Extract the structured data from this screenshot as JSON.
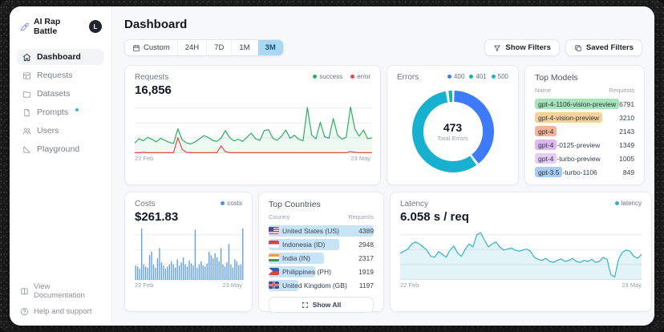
{
  "app": {
    "name": "AI Rap Battle",
    "avatar_initial": "L"
  },
  "sidebar": {
    "items": [
      {
        "label": "Dashboard"
      },
      {
        "label": "Requests"
      },
      {
        "label": "Datasets"
      },
      {
        "label": "Prompts"
      },
      {
        "label": "Users"
      },
      {
        "label": "Playground"
      }
    ],
    "footer": [
      {
        "label": "View Documentation"
      },
      {
        "label": "Help and support"
      }
    ]
  },
  "header": {
    "title": "Dashboard",
    "time_filters": [
      "Custom",
      "24H",
      "7D",
      "1M",
      "3M"
    ],
    "selected_filter": "3M",
    "show_filters": "Show Filters",
    "saved_filters": "Saved Filters"
  },
  "panels": {
    "requests": {
      "title": "Requests",
      "value": "16,856",
      "legend": [
        {
          "label": "success",
          "color": "#2fae62"
        },
        {
          "label": "error",
          "color": "#e5484d"
        }
      ],
      "x_start": "22 Feb",
      "x_end": "23 May"
    },
    "errors": {
      "title": "Errors",
      "total": "473",
      "total_label": "Total Errors",
      "legend": [
        {
          "label": "400",
          "color": "#3e7bfa"
        },
        {
          "label": "401",
          "color": "#18b3a6"
        },
        {
          "label": "500",
          "color": "#17b1cf"
        }
      ]
    },
    "top_models": {
      "title": "Top Models",
      "columns": [
        "Name",
        "Requests"
      ],
      "rows": [
        {
          "badge": "gpt-4-1106-vision-preview",
          "rest": "",
          "requests": "6791",
          "color": "#a9e3b9"
        },
        {
          "badge": "gpt-4-vision-preview",
          "rest": "",
          "requests": "3210",
          "color": "#f6d29a"
        },
        {
          "badge": "gpt-4",
          "rest": "",
          "requests": "2143",
          "color": "#f6b39a"
        },
        {
          "badge": "gpt-4",
          "rest": "-0125-preview",
          "requests": "1349",
          "color": "#ddb6f2"
        },
        {
          "badge": "gpt-4",
          "rest": "-turbo-preview",
          "requests": "1005",
          "color": "#e6cdf6"
        },
        {
          "badge": "gpt-3.5",
          "rest": "-turbo-1106",
          "requests": "849",
          "color": "#a9cdf2"
        }
      ]
    },
    "costs": {
      "title": "Costs",
      "value": "$261.83",
      "legend": [
        {
          "label": "costs",
          "color": "#4f8df0"
        }
      ],
      "x_start": "22 Feb",
      "x_end": "23 May"
    },
    "top_countries": {
      "title": "Top Countries",
      "columns": [
        "Country",
        "Requests"
      ],
      "rows": [
        {
          "name": "United States (US)",
          "requests": "4389",
          "bar_pct": 100
        },
        {
          "name": "Indonesia (ID)",
          "requests": "2948",
          "bar_pct": 67
        },
        {
          "name": "India (IN)",
          "requests": "2317",
          "bar_pct": 53
        },
        {
          "name": "Philippines (PH)",
          "requests": "1919",
          "bar_pct": 44
        },
        {
          "name": "United Kingdom (GB)",
          "requests": "1197",
          "bar_pct": 28
        }
      ],
      "show_all": "Show All"
    },
    "latency": {
      "title": "Latency",
      "value": "6.058 s / req",
      "legend": [
        {
          "label": "latency",
          "color": "#2fb4c4"
        }
      ],
      "x_start": "22 Feb",
      "x_end": "23 May"
    }
  },
  "chart_data": [
    {
      "id": "requests",
      "type": "line",
      "title": "Requests",
      "x_range": [
        "22 Feb",
        "23 May"
      ],
      "ylim": [
        0,
        200
      ],
      "grid": true,
      "legend_position": "top-right",
      "series": [
        {
          "name": "success",
          "color": "#2fae62",
          "fill": true,
          "fill_opacity": 0.08,
          "values": [
            40,
            56,
            48,
            62,
            54,
            44,
            58,
            50,
            42,
            38,
            95,
            52,
            40,
            36,
            44,
            56,
            68,
            62,
            50,
            46,
            58,
            88,
            60,
            48,
            54,
            46,
            62,
            78,
            56,
            50,
            88,
            92,
            58,
            50,
            66,
            90,
            58,
            70,
            54,
            48,
            178,
            70,
            56,
            120,
            64,
            58,
            135,
            70,
            55,
            62,
            180,
            95,
            66,
            90,
            56,
            60
          ]
        },
        {
          "name": "error",
          "color": "#e5484d",
          "fill": false,
          "values": [
            2,
            2,
            3,
            2,
            2,
            2,
            2,
            2,
            2,
            2,
            60,
            15,
            3,
            2,
            2,
            2,
            2,
            2,
            2,
            2,
            28,
            6,
            2,
            2,
            2,
            2,
            2,
            2,
            2,
            2,
            2,
            2,
            2,
            2,
            2,
            2,
            2,
            2,
            2,
            2,
            2,
            2,
            2,
            2,
            2,
            2,
            2,
            2,
            2,
            2,
            6,
            3,
            2,
            2,
            2,
            2
          ]
        }
      ]
    },
    {
      "id": "errors",
      "type": "donut",
      "title": "Errors",
      "total": 473,
      "slices": [
        {
          "label": "400",
          "value": 188,
          "color": "#3e7bfa"
        },
        {
          "label": "401",
          "value": 12,
          "color": "#18b3a6"
        },
        {
          "label": "500",
          "value": 273,
          "color": "#17b1cf"
        }
      ],
      "draw_order": [
        0,
        2,
        1
      ]
    },
    {
      "id": "costs",
      "type": "bar",
      "title": "Costs",
      "x_range": [
        "22 Feb",
        "23 May"
      ],
      "ylim": [
        0,
        100
      ],
      "grid": true,
      "color": "#5f9df0",
      "values": [
        28,
        26,
        22,
        100,
        30,
        26,
        24,
        48,
        55,
        30,
        24,
        42,
        62,
        34,
        28,
        22,
        26,
        30,
        36,
        30,
        24,
        40,
        28,
        34,
        44,
        30,
        26,
        38,
        32,
        28,
        98,
        24,
        30,
        36,
        28,
        26,
        32,
        55,
        48,
        42,
        52,
        44,
        36,
        62,
        30,
        26,
        34,
        70,
        30,
        24,
        40,
        36,
        28,
        30,
        100
      ]
    },
    {
      "id": "latency",
      "type": "line",
      "title": "Latency",
      "x_range": [
        "22 Feb",
        "23 May"
      ],
      "ylim": [
        0,
        100
      ],
      "grid": true,
      "series": [
        {
          "name": "latency",
          "color": "#2fb4c4",
          "fill": true,
          "fill_opacity": 0.14,
          "values": [
            52,
            56,
            60,
            70,
            74,
            70,
            64,
            58,
            46,
            44,
            55,
            50,
            44,
            58,
            66,
            52,
            46,
            60,
            70,
            64,
            88,
            92,
            78,
            64,
            70,
            74,
            64,
            58,
            60,
            62,
            58,
            56,
            58,
            60,
            56,
            44,
            40,
            38,
            42,
            36,
            34,
            38,
            41,
            36,
            38,
            42,
            36,
            34,
            38,
            36,
            40,
            34,
            36,
            44,
            40,
            10,
            6,
            40,
            54,
            58,
            56,
            46,
            42,
            50
          ]
        }
      ]
    }
  ]
}
